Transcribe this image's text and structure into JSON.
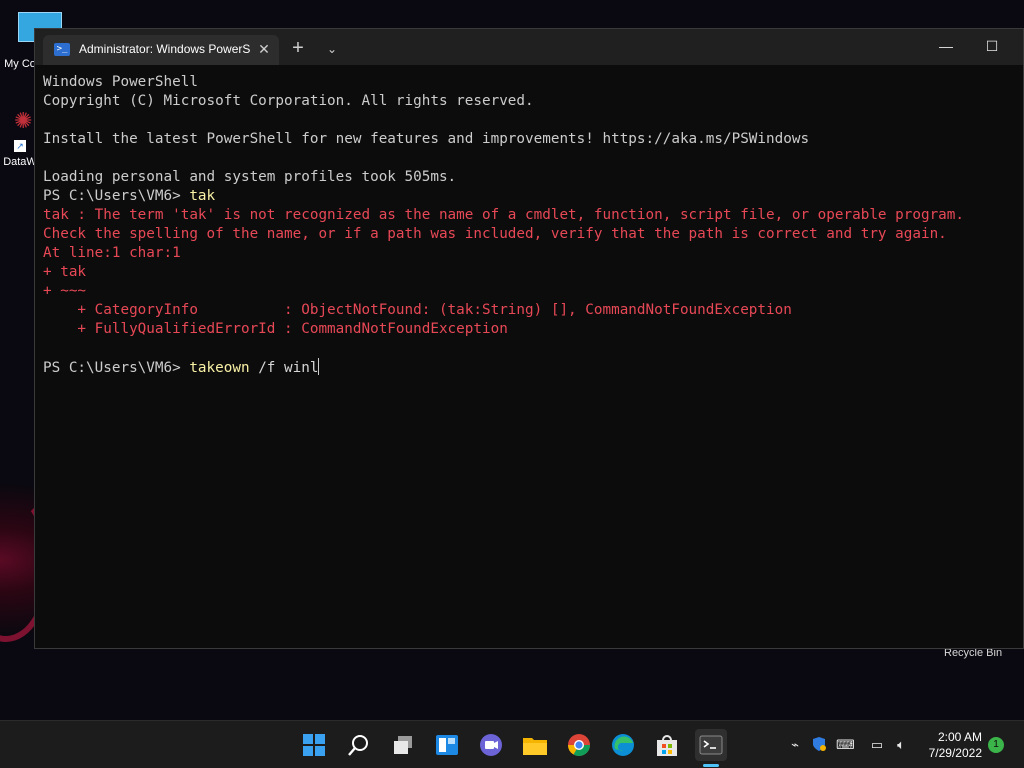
{
  "desktop": {
    "icons": [
      {
        "label": "My Co",
        "name": "this-pc"
      },
      {
        "label": "DataW",
        "name": "dataw-shortcut"
      }
    ],
    "recycle_bin_label": "Recycle Bin"
  },
  "window": {
    "tab_title": "Administrator: Windows PowerShell",
    "tab_icon": "powershell-icon",
    "close_tab_glyph": "✕",
    "new_tab_glyph": "+",
    "dropdown_glyph": "⌄",
    "minimize_glyph": "—",
    "maximize_glyph": "☐"
  },
  "terminal": {
    "lines": [
      {
        "text": "Windows PowerShell",
        "style": "normal"
      },
      {
        "text": "Copyright (C) Microsoft Corporation. All rights reserved.",
        "style": "normal"
      },
      {
        "text": "",
        "style": "normal"
      },
      {
        "text": "Install the latest PowerShell for new features and improvements! https://aka.ms/PSWindows",
        "style": "normal"
      },
      {
        "text": "",
        "style": "normal"
      },
      {
        "text": "Loading personal and system profiles took 505ms.",
        "style": "normal"
      },
      {
        "prompt": "PS C:\\Users\\VM6> ",
        "command": "tak",
        "args": "",
        "style": "prompt"
      },
      {
        "text": "tak : The term 'tak' is not recognized as the name of a cmdlet, function, script file, or operable program.",
        "style": "error"
      },
      {
        "text": "Check the spelling of the name, or if a path was included, verify that the path is correct and try again.",
        "style": "error"
      },
      {
        "text": "At line:1 char:1",
        "style": "error"
      },
      {
        "text": "+ tak",
        "style": "error"
      },
      {
        "text": "+ ~~~",
        "style": "error"
      },
      {
        "text": "    + CategoryInfo          : ObjectNotFound: (tak:String) [], CommandNotFoundException",
        "style": "error"
      },
      {
        "text": "    + FullyQualifiedErrorId : CommandNotFoundException",
        "style": "error"
      },
      {
        "text": "",
        "style": "normal"
      },
      {
        "prompt": "PS C:\\Users\\VM6> ",
        "command": "takeown",
        "args": " /f winl",
        "style": "prompt",
        "cursor": true
      }
    ],
    "colors": {
      "normal": "#cccccc",
      "error": "#e74856",
      "command": "#f9f1a5"
    }
  },
  "taskbar": {
    "apps": [
      {
        "name": "start-icon"
      },
      {
        "name": "search-icon"
      },
      {
        "name": "task-view-icon"
      },
      {
        "name": "widgets-icon"
      },
      {
        "name": "teams-chat-icon"
      },
      {
        "name": "file-explorer-icon"
      },
      {
        "name": "chrome-icon"
      },
      {
        "name": "edge-icon"
      },
      {
        "name": "microsoft-store-icon"
      },
      {
        "name": "terminal-icon",
        "active": true
      }
    ],
    "tray": {
      "icons": [
        "network-off-icon",
        "security-icon",
        "keyboard-icon",
        "display-icon",
        "volume-icon"
      ],
      "time": "2:00 AM",
      "date": "7/29/2022",
      "notification_count": "1"
    }
  }
}
